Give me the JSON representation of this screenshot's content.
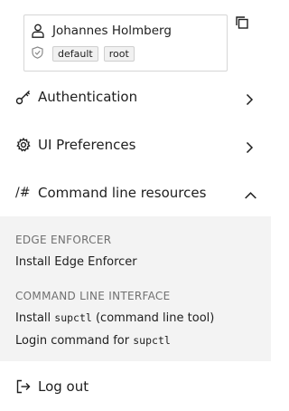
{
  "user": {
    "name": "Johannes Holmberg",
    "tags": [
      "default",
      "root"
    ]
  },
  "menu": {
    "authentication": "Authentication",
    "ui_preferences": "UI Preferences",
    "command_line_resources": "Command line resources",
    "command_line_glyph": "/#",
    "log_out": "Log out"
  },
  "submenu": {
    "edge_enforcer_title": "EDGE ENFORCER",
    "install_edge_enforcer": "Install Edge Enforcer",
    "cli_title": "COMMAND LINE INTERFACE",
    "install_prefix": "Install",
    "install_tool": "supctl",
    "install_suffix": "(command line tool)",
    "login_prefix": "Login command for",
    "login_tool": "supctl"
  },
  "colors": {
    "text": "#1e1e1e",
    "section_title": "#707070",
    "submenu_bg": "#f3f3f3",
    "border": "#d6d6d6"
  },
  "icons": [
    "user-icon",
    "shield-icon",
    "copy-icon",
    "key-icon",
    "gear-icon",
    "chevron-right-icon",
    "chevron-up-icon",
    "logout-icon"
  ]
}
